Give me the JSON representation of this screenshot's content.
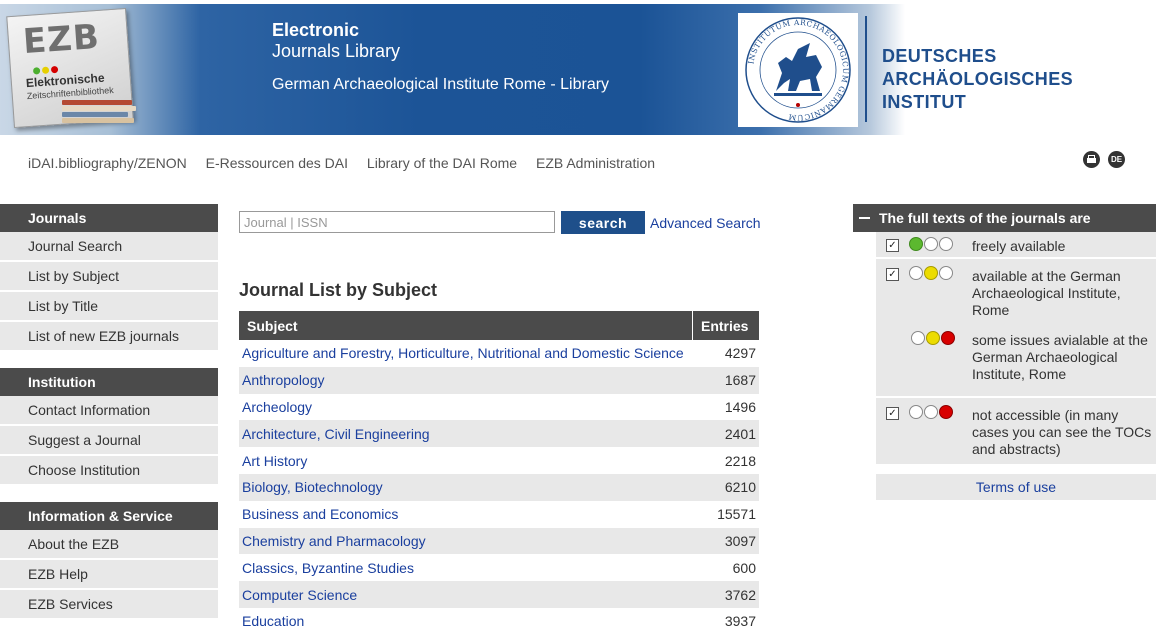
{
  "header": {
    "logo_letters": "EZB",
    "logo_sub1": "Elektronische",
    "logo_sub2": "Zeitschriftenbibliothek",
    "title_line1": "Electronic",
    "title_line2": "Journals Library",
    "institution": "German Archaeological Institute Rome - Library",
    "seal_text": "INSTITUTUM ARCHAEOLOGICUM GERMANICUM",
    "dai_line1": "DEUTSCHES",
    "dai_line2": "ARCHÄOLOGISCHES INSTITUT"
  },
  "topnav": {
    "links": [
      "iDAI.bibliography/ZENON",
      "E-Ressourcen des DAI",
      "Library of the DAI Rome",
      "EZB Administration"
    ],
    "lang_label": "DE"
  },
  "sidebar": {
    "sections": [
      {
        "heading": "Journals",
        "items": [
          "Journal Search",
          "List by Subject",
          "List by Title",
          "List of new EZB journals"
        ]
      },
      {
        "heading": "Institution",
        "items": [
          "Contact Information",
          "Suggest a Journal",
          "Choose Institution"
        ]
      },
      {
        "heading": "Information & Service",
        "items": [
          "About the EZB",
          "EZB Help",
          "EZB Services"
        ]
      }
    ]
  },
  "search": {
    "placeholder": "Journal | ISSN",
    "button": "search",
    "advanced": "Advanced Search"
  },
  "main": {
    "title": "Journal List by Subject",
    "columns": [
      "Subject",
      "Entries"
    ],
    "rows": [
      {
        "subject": "Agriculture and Forestry, Horticulture, Nutritional and Domestic Science",
        "entries": "4297"
      },
      {
        "subject": "Anthropology",
        "entries": "1687"
      },
      {
        "subject": "Archeology",
        "entries": "1496"
      },
      {
        "subject": "Architecture, Civil Engineering",
        "entries": "2401"
      },
      {
        "subject": "Art History",
        "entries": "2218"
      },
      {
        "subject": "Biology, Biotechnology",
        "entries": "6210"
      },
      {
        "subject": "Business and Economics",
        "entries": "15571"
      },
      {
        "subject": "Chemistry and Pharmacology",
        "entries": "3097"
      },
      {
        "subject": "Classics, Byzantine Studies",
        "entries": "600"
      },
      {
        "subject": "Computer Science",
        "entries": "3762"
      },
      {
        "subject": "Education",
        "entries": "3937"
      }
    ]
  },
  "legend": {
    "heading": "The full texts of the journals are",
    "checkmark": "✓",
    "items": [
      {
        "text": "freely available",
        "dots": [
          "green",
          "empty",
          "empty"
        ],
        "checked": true
      },
      {
        "text": "available at the German Archaeological Institute, Rome",
        "dots": [
          "empty",
          "yellow",
          "empty"
        ],
        "checked": true
      },
      {
        "text": "some issues avialable at the German Archaeological Institute, Rome",
        "dots": [
          "empty",
          "yellow",
          "red"
        ],
        "checked": false
      },
      {
        "text": "not accessible (in many cases you can see the TOCs and abstracts)",
        "dots": [
          "empty",
          "empty",
          "red"
        ],
        "checked": true
      }
    ],
    "terms": "Terms of use"
  },
  "colors": {
    "banner_blue": "#1c5497",
    "dark_header": "#4b4b4b",
    "link_blue": "#1a3f9e",
    "search_button": "#1e4f8a",
    "dai_blue": "#1f4e8c"
  }
}
